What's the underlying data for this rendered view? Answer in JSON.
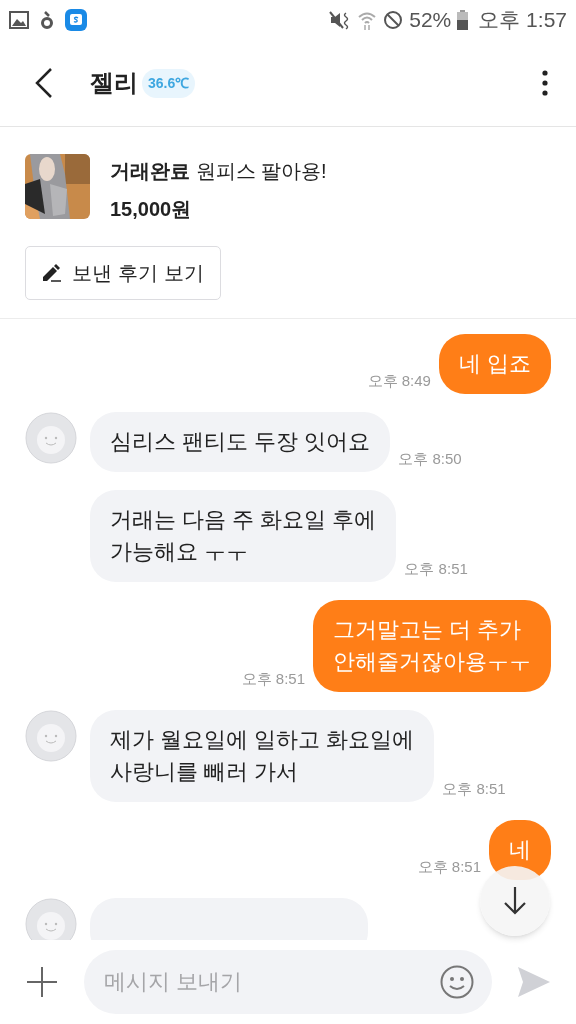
{
  "status_bar": {
    "battery": "52%",
    "time": "오후 1:57"
  },
  "header": {
    "name": "젤리",
    "temperature": "36.6℃"
  },
  "product": {
    "status": "거래완료",
    "title": "원피스 팔아용!",
    "price": "15,000원",
    "review_button": "보낸 후기 보기"
  },
  "messages": [
    {
      "kind": "sent",
      "text": "네 입죠",
      "time": "오후 8:49"
    },
    {
      "kind": "received",
      "avatar": true,
      "text": "심리스 팬티도 두장 잇어요",
      "time": "오후 8:50"
    },
    {
      "kind": "received",
      "avatar": false,
      "text": "거래는 다음 주 화요일 후에\n가능해요 ㅜㅜ",
      "time": "오후 8:51"
    },
    {
      "kind": "sent",
      "text": "그거말고는 더 추가\n안해줄거잖아용ㅜㅜ",
      "time": "오후 8:51"
    },
    {
      "kind": "received",
      "avatar": true,
      "text": "제가 월요일에 일하고 화요일에\n사랑니를 빼러 가서",
      "time": "오후 8:51"
    },
    {
      "kind": "sent",
      "text": "네",
      "time": "오후 8:51"
    },
    {
      "kind": "received_cut",
      "avatar": true
    }
  ],
  "composer": {
    "placeholder": "메시지 보내기"
  }
}
